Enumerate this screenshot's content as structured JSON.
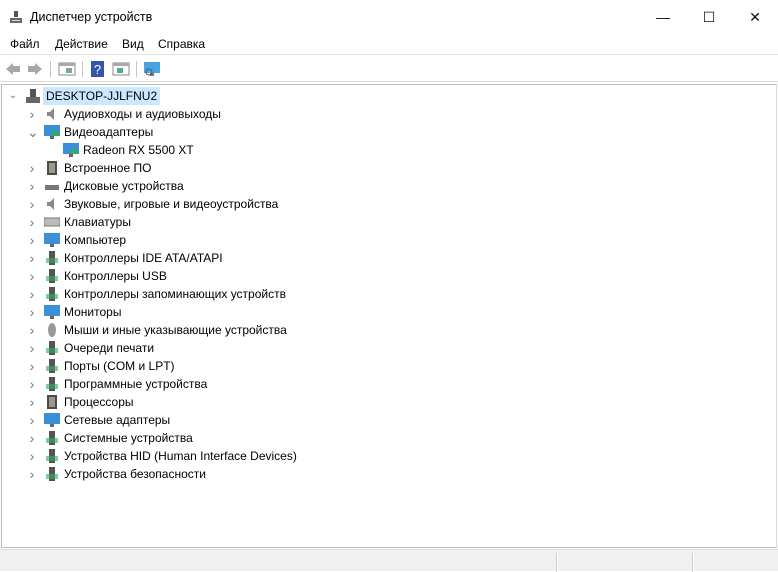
{
  "window": {
    "title": "Диспетчер устройств",
    "minimize": "—",
    "maximize": "☐",
    "close": "✕"
  },
  "menu": [
    "Файл",
    "Действие",
    "Вид",
    "Справка"
  ],
  "toolbar": {
    "buttons": [
      "back-icon",
      "forward-icon",
      "properties-icon",
      "help-icon",
      "update-driver-icon",
      "scan-hardware-icon"
    ]
  },
  "tree": {
    "root": "DESKTOP-JJLFNU2",
    "categories": [
      {
        "label": "Аудиовходы и аудиовыходы",
        "icon": "audio-icon",
        "expanded": false
      },
      {
        "label": "Видеоадаптеры",
        "icon": "display-adapter-icon",
        "expanded": true,
        "children": [
          "Radeon RX 5500 XT"
        ]
      },
      {
        "label": "Встроенное ПО",
        "icon": "firmware-icon",
        "expanded": false
      },
      {
        "label": "Дисковые устройства",
        "icon": "disk-icon",
        "expanded": false
      },
      {
        "label": "Звуковые, игровые и видеоустройства",
        "icon": "sound-icon",
        "expanded": false
      },
      {
        "label": "Клавиатуры",
        "icon": "keyboard-icon",
        "expanded": false
      },
      {
        "label": "Компьютер",
        "icon": "computer-icon",
        "expanded": false
      },
      {
        "label": "Контроллеры IDE ATA/ATAPI",
        "icon": "ide-icon",
        "expanded": false
      },
      {
        "label": "Контроллеры USB",
        "icon": "usb-icon",
        "expanded": false
      },
      {
        "label": "Контроллеры запоминающих устройств",
        "icon": "storage-icon",
        "expanded": false
      },
      {
        "label": "Мониторы",
        "icon": "monitor-icon",
        "expanded": false
      },
      {
        "label": "Мыши и иные указывающие устройства",
        "icon": "mouse-icon",
        "expanded": false
      },
      {
        "label": "Очереди печати",
        "icon": "printer-icon",
        "expanded": false
      },
      {
        "label": "Порты (COM и LPT)",
        "icon": "port-icon",
        "expanded": false
      },
      {
        "label": "Программные устройства",
        "icon": "software-device-icon",
        "expanded": false
      },
      {
        "label": "Процессоры",
        "icon": "processor-icon",
        "expanded": false
      },
      {
        "label": "Сетевые адаптеры",
        "icon": "network-icon",
        "expanded": false
      },
      {
        "label": "Системные устройства",
        "icon": "system-icon",
        "expanded": false
      },
      {
        "label": "Устройства HID (Human Interface Devices)",
        "icon": "hid-icon",
        "expanded": false
      },
      {
        "label": "Устройства безопасности",
        "icon": "security-icon",
        "expanded": false
      }
    ]
  },
  "colors": {
    "selection": "#cce8ff",
    "monitor": "#3a8fd8",
    "chip": "#4a4a4a"
  }
}
